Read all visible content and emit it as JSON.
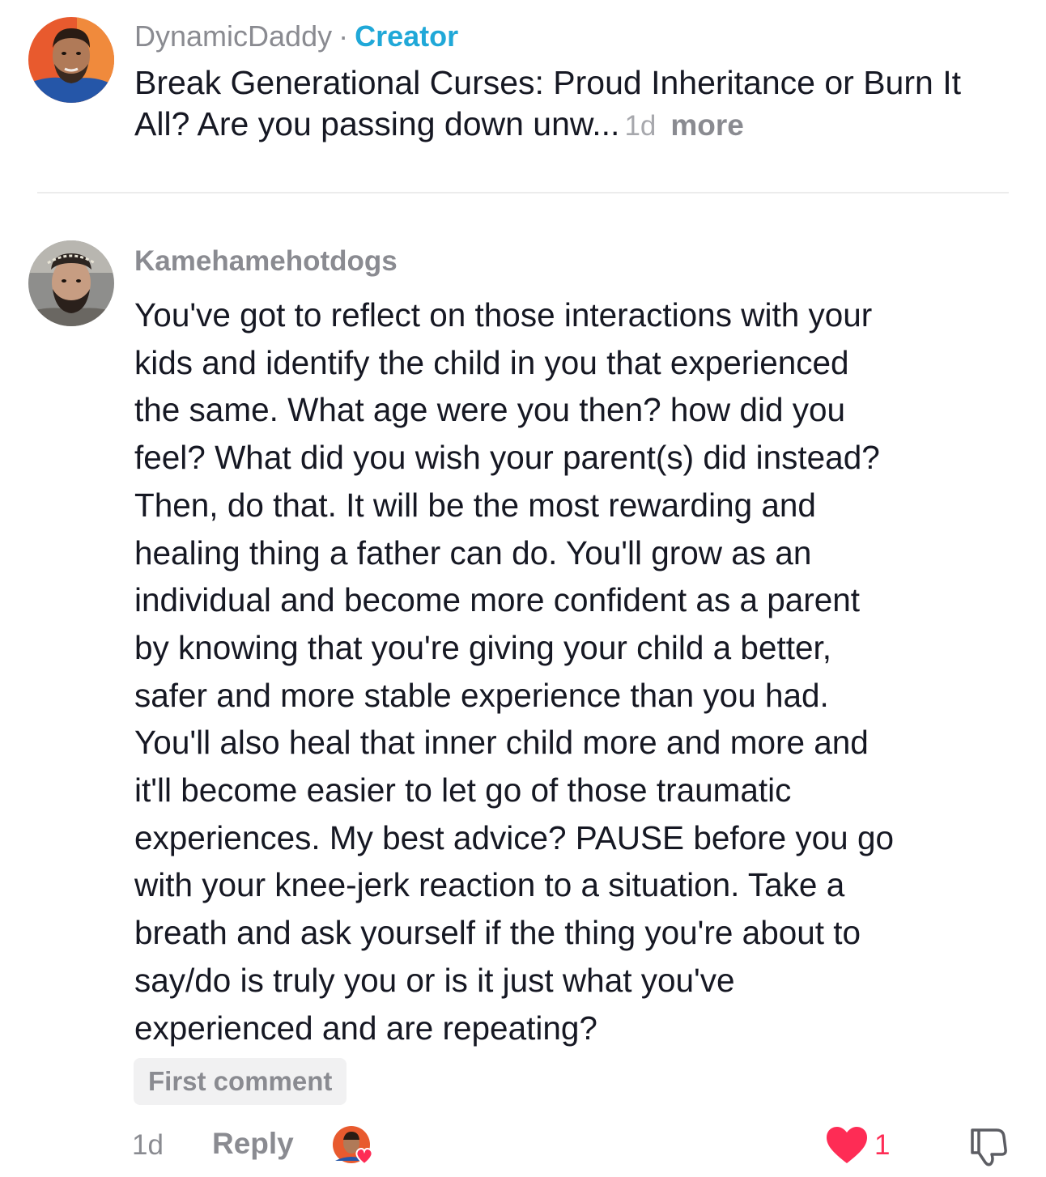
{
  "creator_comment": {
    "username": "DynamicDaddy",
    "separator": "·",
    "badge": "Creator",
    "caption": "Break Generational Curses: Proud Inheritance or Burn It All? Are you passing down unw...",
    "time": "1d",
    "more_label": "more",
    "avatar_icon": "creator-avatar-photo"
  },
  "comment": {
    "username": "Kamehamehotdogs",
    "avatar_icon": "commenter-avatar-photo",
    "lines": [
      "You've got to reflect on those interactions with your",
      "kids and identify the child in you that experienced",
      "the same. What age were you then? how did you",
      "feel? What did you wish your parent(s) did instead?",
      "Then, do that. It will be the most rewarding and",
      "healing thing a father can do. You'll grow as an",
      "individual and become more confident as a parent",
      "by knowing that you're giving your child a better,",
      "safer and more stable experience than you had.",
      "You'll also heal that inner child more and more and",
      "it'll become easier to let go of those traumatic",
      "experiences. My best advice? PAUSE before you go",
      "with your knee-jerk reaction to a situation. Take a",
      "breath and ask yourself if the thing you're about to",
      "say/do is truly you or is it just what you've",
      "experienced and are repeating?"
    ],
    "badge": "First comment",
    "time": "1d",
    "reply_label": "Reply",
    "like_count": "1",
    "liked": true
  },
  "colors": {
    "accent_creator": "#20a8d8",
    "like_red": "#fe2c55",
    "secondary_text": "#8a8b91",
    "primary_text": "#161823"
  }
}
